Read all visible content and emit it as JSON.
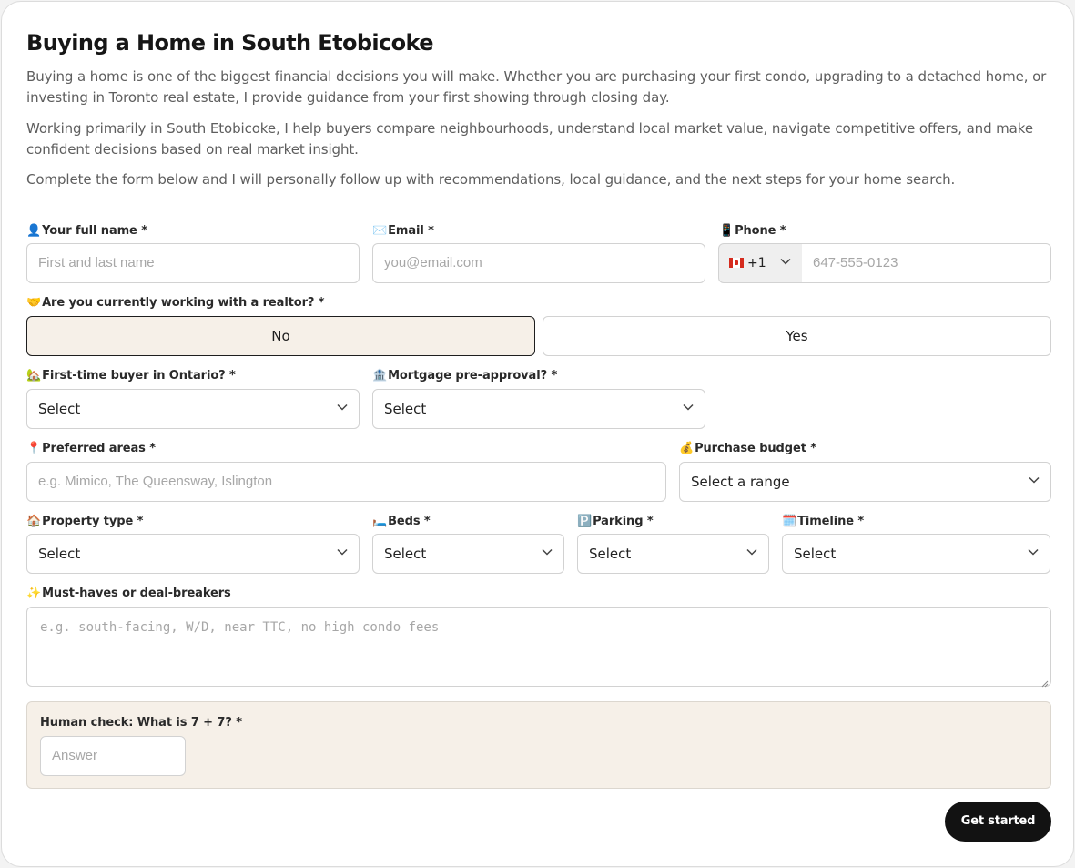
{
  "page": {
    "title": "Buying a Home in South Etobicoke",
    "paragraphs": [
      "Buying a home is one of the biggest financial decisions you will make. Whether you are purchasing your first condo, upgrading to a detached home, or investing in Toronto real estate, I provide guidance from your first showing through closing day.",
      "Working primarily in South Etobicoke, I help buyers compare neighbourhoods, understand local market value, navigate competitive offers, and make confident decisions based on real market insight.",
      "Complete the form below and I will personally follow up with recommendations, local guidance, and the next steps for your home search."
    ]
  },
  "form": {
    "name": {
      "icon": "👤",
      "label": "Your full name *",
      "placeholder": "First and last name",
      "value": ""
    },
    "email": {
      "icon": "✉️",
      "label": "Email *",
      "placeholder": "you@email.com",
      "value": ""
    },
    "phone": {
      "icon": "📱",
      "label": "Phone *",
      "country_code": "+1",
      "flag_icon": "canada-flag-icon",
      "placeholder": "647-555-0123",
      "value": ""
    },
    "realtor": {
      "icon": "🤝",
      "label": "Are you currently working with a realtor? *",
      "options": [
        "No",
        "Yes"
      ],
      "selected": "No"
    },
    "first_time": {
      "icon": "🏡",
      "label": "First-time buyer in Ontario? *",
      "value": "Select"
    },
    "mortgage": {
      "icon": "🏦",
      "label": "Mortgage pre-approval? *",
      "value": "Select"
    },
    "areas": {
      "icon": "📍",
      "label": "Preferred areas *",
      "placeholder": "e.g. Mimico, The Queensway, Islington",
      "value": ""
    },
    "budget": {
      "icon": "💰",
      "label": "Purchase budget *",
      "value": "Select a range"
    },
    "property_type": {
      "icon": "🏠",
      "label": "Property type *",
      "value": "Select"
    },
    "beds": {
      "icon": "🛏️",
      "label": "Beds *",
      "value": "Select"
    },
    "parking": {
      "icon": "🅿️",
      "label": "Parking *",
      "value": "Select"
    },
    "timeline": {
      "icon": "🗓️",
      "label": "Timeline *",
      "value": "Select"
    },
    "must_haves": {
      "icon": "✨",
      "label": "Must-haves or deal-breakers",
      "placeholder": "e.g. south-facing, W/D, near TTC, no high condo fees",
      "value": ""
    },
    "human_check": {
      "label": "Human check: What is 7 + 7? *",
      "placeholder": "Answer",
      "value": ""
    },
    "submit_label": "Get started"
  },
  "colors": {
    "accent_bg": "#f6f0e8",
    "button_bg": "#121212",
    "label_text": "#2a2a2a",
    "body_text": "#5e5e5e"
  }
}
